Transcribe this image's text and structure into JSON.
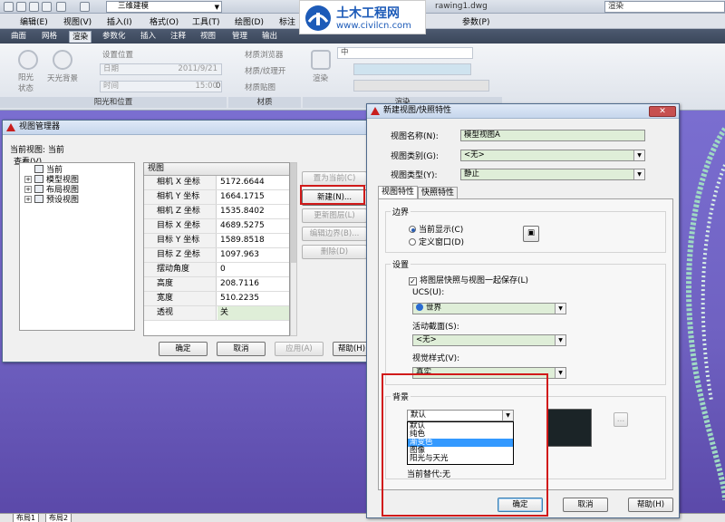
{
  "app": {
    "workspace": "三维建模",
    "doc_title": "rawing1.dwg",
    "search_text": "渲染"
  },
  "watermark": {
    "title": "土木工程网",
    "url": "www.civilcn.com"
  },
  "menubar": [
    "编辑(E)",
    "视图(V)",
    "插入(I)",
    "格式(O)",
    "工具(T)",
    "绘图(D)",
    "标注",
    "参数(P)"
  ],
  "ribbon_tabs": [
    "曲面",
    "网格",
    "渲染",
    "参数化",
    "插入",
    "注释",
    "视图",
    "管理",
    "输出"
  ],
  "ribbon_active_tab": "渲染",
  "ribbon": {
    "sun_state": "阳光\n状态",
    "sky_bg": "天光背景",
    "set_location": "设置位置",
    "date_label": "日期",
    "date_value": "2011/9/21",
    "time_label": "时间",
    "time_value": "15:00",
    "zero_value": "0",
    "sunlight_panel": "阳光和位置",
    "mat_browser": "材质浏览器",
    "mat_texture": "材质/纹理开",
    "mat_map": "材质贴图",
    "materials_panel": "材质",
    "render_btn": "渲染",
    "render_quality": "中",
    "render_panel": "渲染"
  },
  "view_manager": {
    "title": "视图管理器",
    "current_view": "当前视图: 当前",
    "lookup": "查看(V)",
    "tree": [
      "当前",
      "模型视图",
      "布局视图",
      "预设视图"
    ],
    "grid_header": "视图",
    "properties": [
      {
        "k": "相机 X 坐标",
        "v": "5172.6644"
      },
      {
        "k": "相机 Y 坐标",
        "v": "1664.1715"
      },
      {
        "k": "相机 Z 坐标",
        "v": "1535.8402"
      },
      {
        "k": "目标 X 坐标",
        "v": "4689.5275"
      },
      {
        "k": "目标 Y 坐标",
        "v": "1589.8518"
      },
      {
        "k": "目标 Z 坐标",
        "v": "1097.963"
      },
      {
        "k": "摆动角度",
        "v": "0"
      },
      {
        "k": "高度",
        "v": "208.7116"
      },
      {
        "k": "宽度",
        "v": "510.2235"
      },
      {
        "k": "透视",
        "v": "关"
      }
    ],
    "buttons": {
      "set_current": "置为当前(C)",
      "new": "新建(N)...",
      "update_layers": "更新图层(L)",
      "edit_boundary": "编辑边界(B)...",
      "delete": "删除(D)",
      "ok": "确定",
      "cancel": "取消",
      "apply": "应用(A)",
      "help": "帮助(H)"
    }
  },
  "new_view": {
    "title": "新建视图/快照特性",
    "view_name_label": "视图名称(N):",
    "view_name_value": "模型视图A",
    "view_category_label": "视图类别(G):",
    "view_category_value": "<无>",
    "view_type_label": "视图类型(Y):",
    "view_type_value": "静止",
    "tabs": [
      "视图特性",
      "快照特性"
    ],
    "boundary_group": "边界",
    "radio_current": "当前显示(C)",
    "radio_define": "定义窗口(D)",
    "settings_group": "设置",
    "save_layer_snapshot": "将图层快照与视图一起保存(L)",
    "ucs_label": "UCS(U):",
    "ucs_value": "世界",
    "section_label": "活动截面(S):",
    "section_value": "<无>",
    "visual_style_label": "视觉样式(V):",
    "visual_style_value": "真实",
    "background_group": "背景",
    "background_value": "默认",
    "background_options": [
      "默认",
      "纯色",
      "渐变色",
      "图像",
      "阳光与天光"
    ],
    "background_selected_index": 2,
    "current_override": "当前替代:无",
    "ok": "确定",
    "cancel": "取消",
    "help": "帮助(H)"
  },
  "layout_tabs": [
    "布局1",
    "布局2"
  ],
  "colors": {
    "canvas": "#6f63b9",
    "highlight_red": "#d11a1a",
    "field_green": "#dfeed8",
    "selection_blue": "#3399ff",
    "bg_preview": "#1b2427"
  }
}
